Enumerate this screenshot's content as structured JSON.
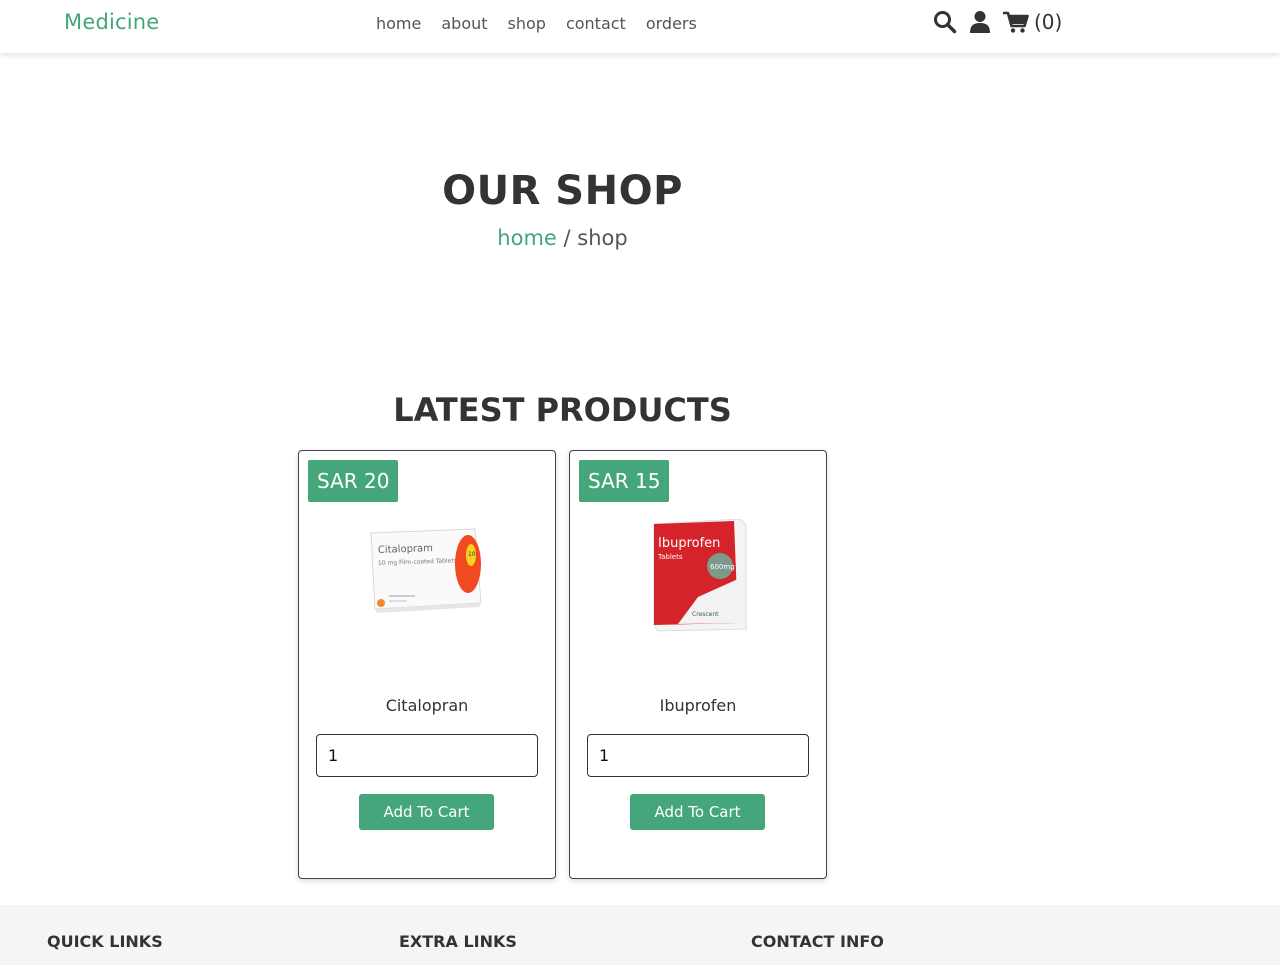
{
  "header": {
    "logo": "Medicine",
    "nav": [
      "home",
      "about",
      "shop",
      "contact",
      "orders"
    ],
    "icons": [
      "search-icon",
      "user-icon",
      "cart-icon"
    ],
    "cart_count": "(0)"
  },
  "hero": {
    "title": "OUR SHOP",
    "breadcrumb_home": "home",
    "breadcrumb_separator": "/",
    "breadcrumb_current": "shop"
  },
  "products_section": {
    "title": "LATEST PRODUCTS",
    "products": [
      {
        "price": "SAR 20",
        "name": "Citalopran",
        "quantity": "1",
        "button": "Add To Cart",
        "box_text": [
          "Citalopram",
          "10 mg Film-coated Tablets",
          "10"
        ]
      },
      {
        "price": "SAR 15",
        "name": "Ibuprofen",
        "quantity": "1",
        "button": "Add To Cart",
        "box_text": [
          "Ibuprofen",
          "Tablets",
          "600mg",
          "Crescent"
        ]
      }
    ]
  },
  "footer": {
    "headings": [
      "QUICK LINKS",
      "EXTRA LINKS",
      "CONTACT INFO"
    ]
  },
  "colors": {
    "accent": "#44a67a",
    "text": "#333333",
    "footer_bg": "#f5f5f5"
  }
}
